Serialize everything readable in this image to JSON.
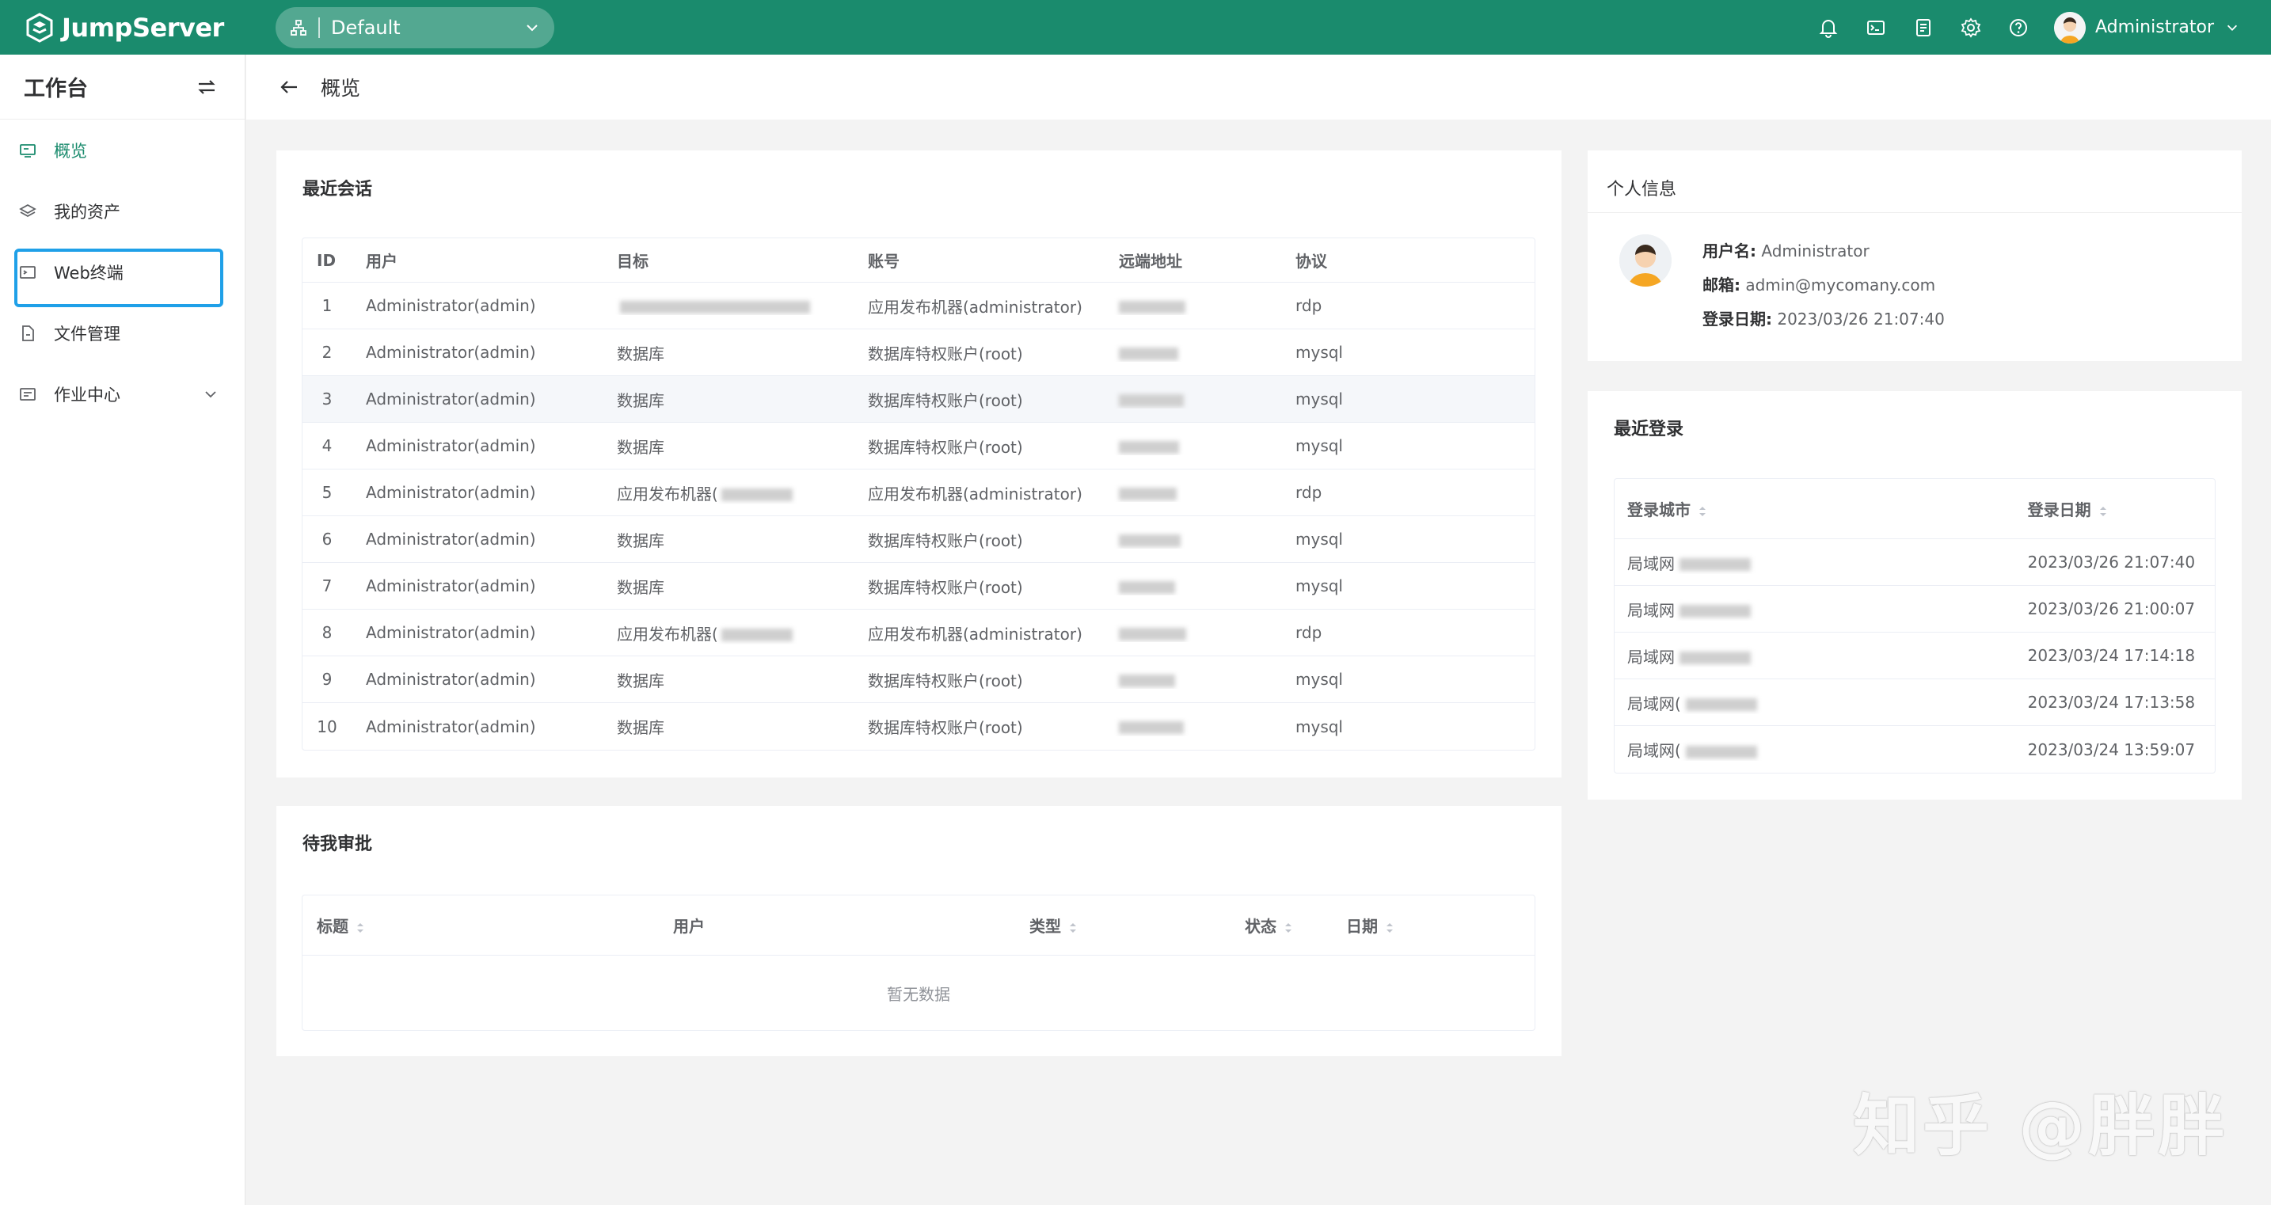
{
  "topbar": {
    "brand": "JumpServer",
    "org": "Default",
    "user": "Administrator"
  },
  "sidebar": {
    "title": "工作台",
    "items": [
      {
        "label": "概览",
        "icon": "monitor-icon"
      },
      {
        "label": "我的资产",
        "icon": "layers-icon"
      },
      {
        "label": "Web终端",
        "icon": "terminal-icon"
      },
      {
        "label": "文件管理",
        "icon": "file-icon"
      },
      {
        "label": "作业中心",
        "icon": "job-icon"
      }
    ]
  },
  "page": {
    "title": "概览"
  },
  "sessions": {
    "title": "最近会话",
    "columns": [
      "ID",
      "用户",
      "目标",
      "账号",
      "远端地址",
      "协议"
    ],
    "rows": [
      {
        "id": "1",
        "user": "Administrator(admin)",
        "target": "",
        "account": "应用发布机器(administrator)",
        "protocol": "rdp"
      },
      {
        "id": "2",
        "user": "Administrator(admin)",
        "target": "数据库",
        "account": "数据库特权账户(root)",
        "protocol": "mysql"
      },
      {
        "id": "3",
        "user": "Administrator(admin)",
        "target": "数据库",
        "account": "数据库特权账户(root)",
        "protocol": "mysql"
      },
      {
        "id": "4",
        "user": "Administrator(admin)",
        "target": "数据库",
        "account": "数据库特权账户(root)",
        "protocol": "mysql"
      },
      {
        "id": "5",
        "user": "Administrator(admin)",
        "target": "应用发布机器(",
        "account": "应用发布机器(administrator)",
        "protocol": "rdp"
      },
      {
        "id": "6",
        "user": "Administrator(admin)",
        "target": "数据库",
        "account": "数据库特权账户(root)",
        "protocol": "mysql"
      },
      {
        "id": "7",
        "user": "Administrator(admin)",
        "target": "数据库",
        "account": "数据库特权账户(root)",
        "protocol": "mysql"
      },
      {
        "id": "8",
        "user": "Administrator(admin)",
        "target": "应用发布机器(",
        "account": "应用发布机器(administrator)",
        "protocol": "rdp"
      },
      {
        "id": "9",
        "user": "Administrator(admin)",
        "target": "数据库",
        "account": "数据库特权账户(root)",
        "protocol": "mysql"
      },
      {
        "id": "10",
        "user": "Administrator(admin)",
        "target": "数据库",
        "account": "数据库特权账户(root)",
        "protocol": "mysql"
      }
    ]
  },
  "approvals": {
    "title": "待我审批",
    "columns": [
      "标题",
      "用户",
      "类型",
      "状态",
      "日期"
    ],
    "empty": "暂无数据"
  },
  "profile": {
    "title": "个人信息",
    "username_label": "用户名:",
    "username": "Administrator",
    "email_label": "邮箱:",
    "email": "admin@mycomany.com",
    "login_label": "登录日期:",
    "login_date": "2023/03/26 21:07:40"
  },
  "logins": {
    "title": "最近登录",
    "columns": [
      "登录城市",
      "登录日期"
    ],
    "rows": [
      {
        "city": "局域网",
        "date": "2023/03/26 21:07:40"
      },
      {
        "city": "局域网",
        "date": "2023/03/26 21:00:07"
      },
      {
        "city": "局域网",
        "date": "2023/03/24 17:14:18"
      },
      {
        "city": "局域网(",
        "date": "2023/03/24 17:13:58"
      },
      {
        "city": "局域网(",
        "date": "2023/03/24 13:59:07"
      }
    ]
  },
  "watermark": "知乎 @胖胖",
  "colors": {
    "brand": "#1a8b6d",
    "highlight": "#1fa0e8"
  }
}
